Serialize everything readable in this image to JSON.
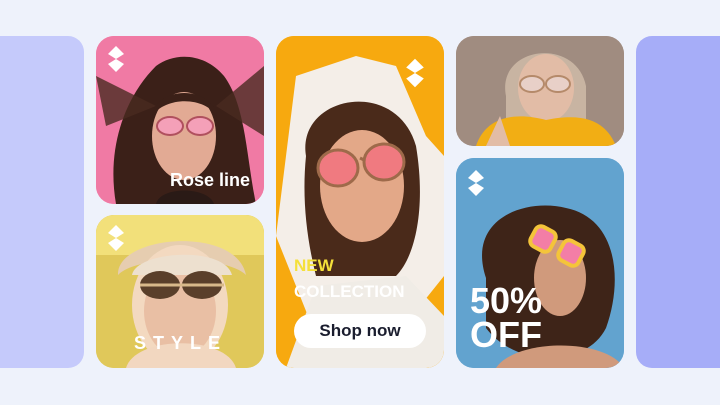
{
  "cards": {
    "rose": {
      "title": "Rose line"
    },
    "style": {
      "title": "STYLE"
    },
    "collection": {
      "new_label": "NEW",
      "collection_label": "COLLECTION",
      "cta_label": "Shop now"
    },
    "sale": {
      "line1": "50%",
      "line2": "OFF"
    }
  },
  "icons": {
    "brand": "brand-diamond-logo-icon"
  },
  "colors": {
    "accent_yellow": "#f5e03a",
    "cta_text": "#1a1d2e",
    "background": "#eef2fb"
  }
}
